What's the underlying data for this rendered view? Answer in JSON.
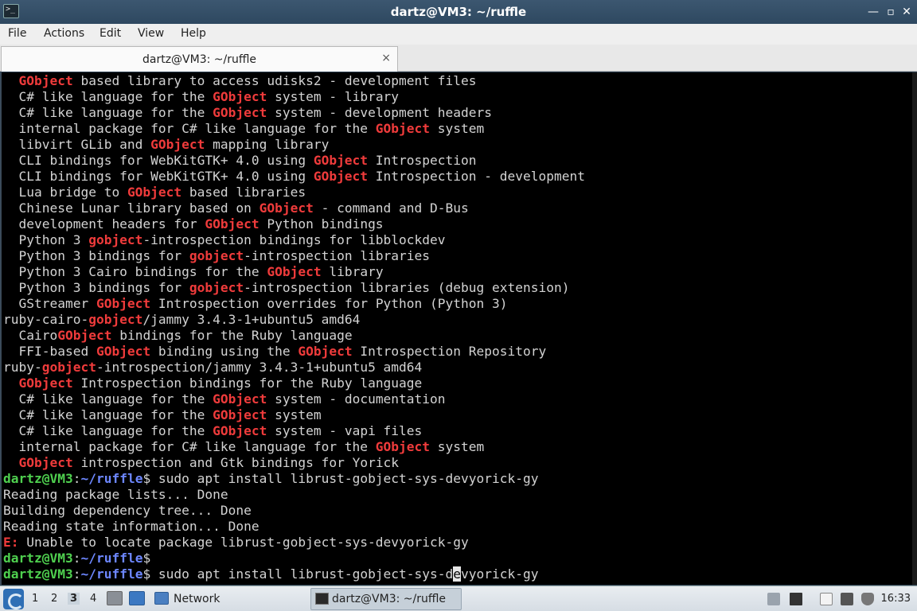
{
  "window": {
    "title": "dartz@VM3: ~/ruffle",
    "minimize": "—",
    "maximize": "▫",
    "close": "✕"
  },
  "menu": [
    "File",
    "Actions",
    "Edit",
    "View",
    "Help"
  ],
  "tab": {
    "label": "dartz@VM3: ~/ruffle",
    "close": "×"
  },
  "prompt": {
    "user": "dartz@VM3",
    "path": "~/ruffle"
  },
  "terminal_lines": [
    [
      [
        "  ",
        ""
      ],
      [
        "GObject",
        "hl"
      ],
      [
        " based library to access udisks2 - development files",
        ""
      ]
    ],
    [
      [
        "  C# like language for the ",
        ""
      ],
      [
        "GObject",
        "hl"
      ],
      [
        " system - library",
        ""
      ]
    ],
    [
      [
        "  C# like language for the ",
        ""
      ],
      [
        "GObject",
        "hl"
      ],
      [
        " system - development headers",
        ""
      ]
    ],
    [
      [
        "  internal package for C# like language for the ",
        ""
      ],
      [
        "GObject",
        "hl"
      ],
      [
        " system",
        ""
      ]
    ],
    [
      [
        "  libvirt GLib and ",
        ""
      ],
      [
        "GObject",
        "hl"
      ],
      [
        " mapping library",
        ""
      ]
    ],
    [
      [
        "  CLI bindings for WebKitGTK+ 4.0 using ",
        ""
      ],
      [
        "GObject",
        "hl"
      ],
      [
        " Introspection",
        ""
      ]
    ],
    [
      [
        "  CLI bindings for WebKitGTK+ 4.0 using ",
        ""
      ],
      [
        "GObject",
        "hl"
      ],
      [
        " Introspection - development",
        ""
      ]
    ],
    [
      [
        "  Lua bridge to ",
        ""
      ],
      [
        "GObject",
        "hl"
      ],
      [
        " based libraries",
        ""
      ]
    ],
    [
      [
        "  Chinese Lunar library based on ",
        ""
      ],
      [
        "GObject",
        "hl"
      ],
      [
        " - command and D-Bus",
        ""
      ]
    ],
    [
      [
        "  development headers for ",
        ""
      ],
      [
        "GObject",
        "hl"
      ],
      [
        " Python bindings",
        ""
      ]
    ],
    [
      [
        "  Python 3 ",
        ""
      ],
      [
        "gobject",
        "hl"
      ],
      [
        "-introspection bindings for libblockdev",
        ""
      ]
    ],
    [
      [
        "  Python 3 bindings for ",
        ""
      ],
      [
        "gobject",
        "hl"
      ],
      [
        "-introspection libraries",
        ""
      ]
    ],
    [
      [
        "  Python 3 Cairo bindings for the ",
        ""
      ],
      [
        "GObject",
        "hl"
      ],
      [
        " library",
        ""
      ]
    ],
    [
      [
        "  Python 3 bindings for ",
        ""
      ],
      [
        "gobject",
        "hl"
      ],
      [
        "-introspection libraries (debug extension)",
        ""
      ]
    ],
    [
      [
        "  GStreamer ",
        ""
      ],
      [
        "GObject",
        "hl"
      ],
      [
        " Introspection overrides for Python (Python 3)",
        ""
      ]
    ],
    [
      [
        "ruby-cairo-",
        ""
      ],
      [
        "gobject",
        "hl"
      ],
      [
        "/jammy 3.4.3-1+ubuntu5 amd64",
        ""
      ]
    ],
    [
      [
        "  Cairo",
        ""
      ],
      [
        "GObject",
        "hl"
      ],
      [
        " bindings for the Ruby language",
        ""
      ]
    ],
    [
      [
        "  FFI-based ",
        ""
      ],
      [
        "GObject",
        "hl"
      ],
      [
        " binding using the ",
        ""
      ],
      [
        "GObject",
        "hl"
      ],
      [
        " Introspection Repository",
        ""
      ]
    ],
    [
      [
        "ruby-",
        ""
      ],
      [
        "gobject",
        "hl"
      ],
      [
        "-introspection/jammy 3.4.3-1+ubuntu5 amd64",
        ""
      ]
    ],
    [
      [
        "  ",
        ""
      ],
      [
        "GObject",
        "hl"
      ],
      [
        " Introspection bindings for the Ruby language",
        ""
      ]
    ],
    [
      [
        "  C# like language for the ",
        ""
      ],
      [
        "GObject",
        "hl"
      ],
      [
        " system - documentation",
        ""
      ]
    ],
    [
      [
        "  C# like language for the ",
        ""
      ],
      [
        "GObject",
        "hl"
      ],
      [
        " system",
        ""
      ]
    ],
    [
      [
        "  C# like language for the ",
        ""
      ],
      [
        "GObject",
        "hl"
      ],
      [
        " system - vapi files",
        ""
      ]
    ],
    [
      [
        "  internal package for C# like language for the ",
        ""
      ],
      [
        "GObject",
        "hl"
      ],
      [
        " system",
        ""
      ]
    ],
    [
      [
        "  ",
        ""
      ],
      [
        "GObject",
        "hl"
      ],
      [
        " introspection and Gtk bindings for Yorick",
        ""
      ]
    ],
    [
      [
        "dartz@VM3",
        "pu"
      ],
      [
        ":",
        ""
      ],
      [
        "~/ruffle",
        "pd"
      ],
      [
        "$ sudo apt install librust-gobject-sys-devyorick-gy",
        ""
      ]
    ],
    [
      [
        "Reading package lists... Done",
        ""
      ]
    ],
    [
      [
        "Building dependency tree... Done",
        ""
      ]
    ],
    [
      [
        "Reading state information... Done",
        ""
      ]
    ],
    [
      [
        "E:",
        "err"
      ],
      [
        " Unable to locate package librust-gobject-sys-devyorick-gy",
        ""
      ]
    ],
    [
      [
        "dartz@VM3",
        "pu"
      ],
      [
        ":",
        ""
      ],
      [
        "~/ruffle",
        "pd"
      ],
      [
        "$",
        ""
      ]
    ],
    [
      [
        "dartz@VM3",
        "pu"
      ],
      [
        ":",
        ""
      ],
      [
        "~/ruffle",
        "pd"
      ],
      [
        "$ sudo apt install librust-gobject-sys-d",
        ""
      ],
      [
        "e",
        "cur"
      ],
      [
        "vyorick-gy",
        ""
      ]
    ]
  ],
  "taskbar": {
    "workspaces": [
      "1",
      "2",
      "3",
      "4"
    ],
    "active_workspace": "3",
    "folder_label": "Network",
    "task_label": "dartz@VM3: ~/ruffle",
    "clock": "16:33",
    "icons": [
      "start-menu-icon",
      "desktop-icon",
      "file-manager-icon",
      "folder-icon",
      "terminal-icon",
      "tray-up-icon",
      "volume-icon",
      "clipboard-icon",
      "network-icon",
      "shield-icon"
    ]
  }
}
